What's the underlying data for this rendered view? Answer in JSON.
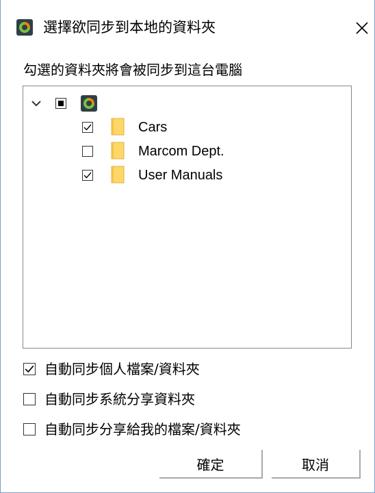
{
  "title_bar": {
    "title": "選擇欲同步到本地的資料夾",
    "app_icon": "sync-app-icon",
    "close_label": "✕"
  },
  "instruction": "勾選的資料夾將會被同步到這台電腦",
  "tree": {
    "root": {
      "expanded": true,
      "state": "indeterminate",
      "icon": "sync-app-icon",
      "label": ""
    },
    "items": [
      {
        "label": "Cars",
        "checked": true,
        "icon": "folder-icon"
      },
      {
        "label": "Marcom Dept.",
        "checked": false,
        "icon": "folder-icon"
      },
      {
        "label": "User Manuals",
        "checked": true,
        "icon": "folder-icon"
      }
    ]
  },
  "options": [
    {
      "label": "自動同步個人檔案/資料夾",
      "checked": true
    },
    {
      "label": "自動同步系統分享資料夾",
      "checked": false
    },
    {
      "label": "自動同步分享給我的檔案/資料夾",
      "checked": false
    }
  ],
  "buttons": {
    "ok": "確定",
    "cancel": "取消"
  },
  "colors": {
    "window_border": "#7a9ec6",
    "folder_fill": "#ffd767",
    "folder_edge": "#e0b040",
    "app_icon_dark": "#2f3f47",
    "app_icon_accent": "#ff7b00",
    "app_icon_green": "#7bc043"
  }
}
